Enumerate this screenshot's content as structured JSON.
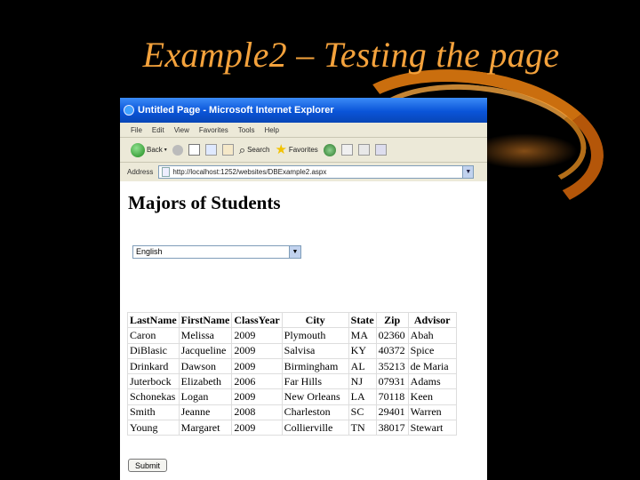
{
  "slide": {
    "title": "Example2 – Testing the page"
  },
  "browser": {
    "window_title": "Untitled Page - Microsoft Internet Explorer",
    "menu": [
      "File",
      "Edit",
      "View",
      "Favorites",
      "Tools",
      "Help"
    ],
    "toolbar": {
      "back": "Back",
      "search": "Search",
      "favorites": "Favorites"
    },
    "address_label": "Address",
    "address_value": "http://localhost:1252/websites/DBExample2.aspx"
  },
  "page": {
    "heading": "Majors of Students",
    "major_select": {
      "value": "English"
    },
    "table": {
      "headers": [
        "LastName",
        "FirstName",
        "ClassYear",
        "City",
        "State",
        "Zip",
        "Advisor"
      ],
      "rows": [
        [
          "Caron",
          "Melissa",
          "2009",
          "Plymouth",
          "MA",
          "02360",
          "Abah"
        ],
        [
          "DiBlasic",
          "Jacqueline",
          "2009",
          "Salvisa",
          "KY",
          "40372",
          "Spice"
        ],
        [
          "Drinkard",
          "Dawson",
          "2009",
          "Birmingham",
          "AL",
          "35213",
          "de Maria"
        ],
        [
          "Juterbock",
          "Elizabeth",
          "2006",
          "Far Hills",
          "NJ",
          "07931",
          "Adams"
        ],
        [
          "Schonekas",
          "Logan",
          "2009",
          "New Orleans",
          "LA",
          "70118",
          "Keen"
        ],
        [
          "Smith",
          "Jeanne",
          "2008",
          "Charleston",
          "SC",
          "29401",
          "Warren"
        ],
        [
          "Young",
          "Margaret",
          "2009",
          "Collierville",
          "TN",
          "38017",
          "Stewart"
        ]
      ]
    },
    "submit_label": "Submit"
  },
  "colors": {
    "title_orange": "#f4a23c",
    "ie_blue": "#0a54d8",
    "background": "#000000"
  }
}
